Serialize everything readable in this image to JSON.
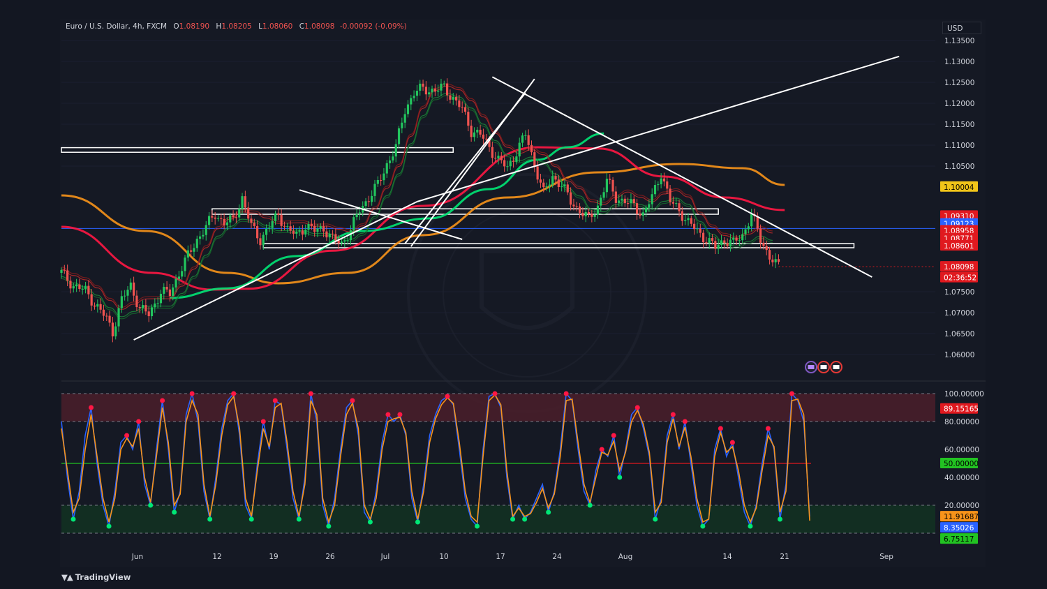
{
  "header": {
    "symbol": "Euro / U.S. Dollar, 4h, FXCM",
    "open_label": "O",
    "open": "1.08190",
    "high_label": "H",
    "high": "1.08205",
    "low_label": "L",
    "low": "1.08060",
    "close_label": "C",
    "close": "1.08098",
    "change": "-0.00092 (-0.09%)"
  },
  "currency_button": "USD",
  "brand": "TradingView",
  "colors": {
    "up": "#26a69a",
    "down": "#ef5350",
    "ema_fast": "#00e676",
    "ema_red": "#ff1744",
    "ma_orange": "#f7931a",
    "ma_olive": "#c9b037",
    "trendline": "#ffffff",
    "zone": "#ffffff",
    "stoch_k": "#2962ff",
    "stoch_d": "#f7931a",
    "overbought_fill": "#4a1f2a",
    "oversold_fill": "#123322"
  },
  "chart_data": [
    {
      "type": "candlestick",
      "title": "Euro / U.S. Dollar, 4h, FXCM",
      "x_ticks": [
        "Jun",
        "12",
        "19",
        "26",
        "Jul",
        "10",
        "17",
        "24",
        "Aug",
        "14",
        "21",
        "Sep"
      ],
      "y_ticks": [
        "1.13500",
        "1.13000",
        "1.12500",
        "1.12000",
        "1.11500",
        "1.11000",
        "1.10500",
        "1.07500",
        "1.07000",
        "1.06500",
        "1.06000"
      ],
      "ylim": [
        1.055,
        1.138
      ],
      "price_labels": [
        {
          "value": "1.10004",
          "color": "#f0c419",
          "text_color": "#000000",
          "price": 1.10004
        },
        {
          "value": "1.09310",
          "color": "#e0191f",
          "text_color": "#ffffff",
          "price": 1.0931
        },
        {
          "value": "1.09123",
          "color": "#2962ff",
          "text_color": "#ffffff",
          "price": 1.09123
        },
        {
          "value": "1.08958",
          "color": "#e0191f",
          "text_color": "#ffffff",
          "price": 1.08958
        },
        {
          "value": "1.08771",
          "color": "#e0191f",
          "text_color": "#ffffff",
          "price": 1.08771
        },
        {
          "value": "1.08601",
          "color": "#e0191f",
          "text_color": "#ffffff",
          "price": 1.08601
        },
        {
          "value": "1.08098",
          "color": "#e0191f",
          "text_color": "#ffffff",
          "price": 1.08098
        },
        {
          "value": "02:36:52",
          "color": "#e0191f",
          "text_color": "#ffffff",
          "price": 1.0784
        }
      ],
      "close_path": [
        [
          0,
          1.0795
        ],
        [
          4,
          1.0765
        ],
        [
          8,
          1.0752
        ],
        [
          11,
          1.0722
        ],
        [
          15,
          1.0685
        ],
        [
          17,
          1.0655
        ],
        [
          20,
          1.073
        ],
        [
          23,
          1.0765
        ],
        [
          26,
          1.071
        ],
        [
          29,
          1.0695
        ],
        [
          33,
          1.075
        ],
        [
          36,
          1.0745
        ],
        [
          39,
          1.0795
        ],
        [
          42,
          1.0835
        ],
        [
          45,
          1.0875
        ],
        [
          48,
          1.0905
        ],
        [
          51,
          1.0935
        ],
        [
          54,
          1.0915
        ],
        [
          57,
          1.092
        ],
        [
          60,
          1.0975
        ],
        [
          63,
          1.0905
        ],
        [
          66,
          1.0875
        ],
        [
          69,
          1.0905
        ],
        [
          72,
          1.0935
        ],
        [
          75,
          1.0898
        ],
        [
          78,
          1.0885
        ],
        [
          81,
          1.0908
        ],
        [
          84,
          1.0895
        ],
        [
          87,
          1.0903
        ],
        [
          90,
          1.0875
        ],
        [
          93,
          1.0865
        ],
        [
          96,
          1.0898
        ],
        [
          99,
          1.0945
        ],
        [
          102,
          1.0975
        ],
        [
          105,
          1.1005
        ],
        [
          108,
          1.1055
        ],
        [
          111,
          1.1095
        ],
        [
          114,
          1.1185
        ],
        [
          117,
          1.1225
        ],
        [
          120,
          1.1235
        ],
        [
          124,
          1.123
        ],
        [
          127,
          1.1238
        ],
        [
          130,
          1.1212
        ],
        [
          133,
          1.1185
        ],
        [
          136,
          1.1135
        ],
        [
          139,
          1.1125
        ],
        [
          142,
          1.1095
        ],
        [
          145,
          1.1065
        ],
        [
          148,
          1.1045
        ],
        [
          151,
          1.1085
        ],
        [
          154,
          1.1125
        ],
        [
          157,
          1.1055
        ],
        [
          160,
          1.0985
        ],
        [
          163,
          1.1025
        ],
        [
          166,
          1.1005
        ],
        [
          169,
          1.0965
        ],
        [
          172,
          1.0945
        ],
        [
          175,
          1.0922
        ],
        [
          178,
          1.0955
        ],
        [
          181,
          1.1015
        ],
        [
          184,
          1.0975
        ],
        [
          187,
          1.0965
        ],
        [
          190,
          1.0955
        ],
        [
          193,
          1.0935
        ],
        [
          196,
          1.0975
        ],
        [
          199,
          1.1035
        ],
        [
          202,
          1.0965
        ],
        [
          205,
          1.0945
        ],
        [
          208,
          1.0915
        ],
        [
          211,
          1.0895
        ],
        [
          214,
          1.0875
        ],
        [
          217,
          1.0855
        ],
        [
          220,
          1.0875
        ],
        [
          223,
          1.0865
        ],
        [
          226,
          1.0885
        ],
        [
          229,
          1.0935
        ],
        [
          232,
          1.0875
        ],
        [
          235,
          1.0835
        ],
        [
          237,
          1.0815
        ],
        [
          238,
          1.081
        ]
      ],
      "resistance_zones": [
        {
          "from": 0,
          "to": 130,
          "low": 1.1083,
          "high": 1.1094
        },
        {
          "from": 50,
          "to": 218,
          "low": 1.0935,
          "high": 1.0948
        },
        {
          "from": 67,
          "to": 263,
          "low": 1.0855,
          "high": 1.0865
        }
      ],
      "trendlines": [
        [
          [
            24,
            1.0635
          ],
          [
            118,
            1.0965
          ]
        ],
        [
          [
            118,
            1.0965
          ],
          [
            278,
            1.1312
          ]
        ],
        [
          [
            79,
            1.0993
          ],
          [
            133,
            1.0875
          ]
        ],
        [
          [
            143,
            1.1263
          ],
          [
            269,
            1.0785
          ]
        ],
        [
          [
            116,
            1.0858
          ],
          [
            157,
            1.1258
          ]
        ],
        [
          [
            114,
            1.0865
          ],
          [
            154,
            1.1225
          ]
        ]
      ],
      "horizontal_line": {
        "price": 1.0901,
        "color": "#2962ff"
      },
      "moving_averages": [
        {
          "color": "#f7931a",
          "points": [
            [
              0,
              1.098
            ],
            [
              28,
              1.0895
            ],
            [
              55,
              1.0795
            ],
            [
              72,
              1.077
            ],
            [
              95,
              1.0795
            ],
            [
              120,
              1.0885
            ],
            [
              148,
              1.0975
            ],
            [
              178,
              1.1035
            ],
            [
              205,
              1.1055
            ],
            [
              226,
              1.1045
            ],
            [
              240,
              1.1005
            ]
          ]
        },
        {
          "color": "#ff1744",
          "points": [
            [
              0,
              1.0905
            ],
            [
              30,
              1.0795
            ],
            [
              50,
              1.0755
            ],
            [
              62,
              1.0757
            ],
            [
              90,
              1.0848
            ],
            [
              120,
              1.0955
            ],
            [
              158,
              1.1095
            ],
            [
              178,
              1.1092
            ],
            [
              200,
              1.1025
            ],
            [
              220,
              1.0975
            ],
            [
              240,
              1.0945
            ]
          ]
        },
        {
          "color": "#00e676",
          "points": [
            [
              36,
              1.0735
            ],
            [
              55,
              1.0758
            ],
            [
              78,
              1.0835
            ],
            [
              100,
              1.0895
            ],
            [
              122,
              1.0925
            ],
            [
              142,
              1.0995
            ],
            [
              158,
              1.1065
            ],
            [
              168,
              1.1095
            ],
            [
              180,
              1.1128
            ]
          ]
        }
      ],
      "event_icons": [
        "lightning-icon",
        "us-flag-icon",
        "us-flag-icon"
      ]
    },
    {
      "type": "line",
      "title": "Stochastic",
      "y_ticks": [
        "100.00000",
        "80.00000",
        "60.00000",
        "40.00000",
        "20.00000"
      ],
      "ylim": [
        0,
        100
      ],
      "levels": {
        "overbought": 80,
        "middle": 50,
        "oversold": 20,
        "top": 100,
        "bottom": 0
      },
      "value_labels": [
        {
          "value": "89.15165",
          "color": "#e0191f",
          "text_color": "#ffffff",
          "level": 89.15
        },
        {
          "value": "50.00000",
          "color": "#22c322",
          "text_color": "#000000",
          "level": 50
        },
        {
          "value": "11.91687",
          "color": "#f7931a",
          "text_color": "#000000",
          "level": 11.92
        },
        {
          "value": "8.35026",
          "color": "#2962ff",
          "text_color": "#ffffff",
          "level": 8.35
        },
        {
          "value": "6.75117",
          "color": "#22c322",
          "text_color": "#000000",
          "level": 6.75
        }
      ],
      "series_k": [
        80,
        40,
        10,
        30,
        70,
        90,
        50,
        20,
        5,
        30,
        65,
        70,
        60,
        80,
        35,
        20,
        60,
        95,
        60,
        15,
        30,
        85,
        100,
        80,
        30,
        10,
        40,
        75,
        95,
        100,
        70,
        20,
        10,
        50,
        80,
        60,
        95,
        92,
        60,
        25,
        10,
        40,
        100,
        80,
        20,
        5,
        25,
        60,
        90,
        95,
        70,
        15,
        8,
        30,
        65,
        85,
        80,
        85,
        70,
        25,
        8,
        35,
        70,
        85,
        95,
        98,
        92,
        60,
        25,
        10,
        5,
        60,
        98,
        100,
        90,
        40,
        10,
        20,
        10,
        15,
        25,
        35,
        15,
        30,
        60,
        100,
        95,
        60,
        30,
        20,
        45,
        60,
        55,
        70,
        40,
        60,
        85,
        90,
        75,
        55,
        10,
        25,
        70,
        85,
        60,
        80,
        50,
        20,
        5,
        10,
        60,
        75,
        55,
        65,
        40,
        15,
        5,
        20,
        50,
        75,
        60,
        10,
        35,
        100,
        95,
        80,
        12
      ],
      "series_d": [
        75,
        45,
        15,
        25,
        60,
        85,
        55,
        25,
        8,
        25,
        60,
        68,
        62,
        75,
        40,
        22,
        55,
        90,
        65,
        20,
        28,
        80,
        95,
        85,
        35,
        12,
        35,
        70,
        92,
        98,
        75,
        25,
        12,
        45,
        75,
        62,
        90,
        93,
        65,
        30,
        12,
        35,
        95,
        85,
        25,
        8,
        20,
        55,
        85,
        93,
        75,
        20,
        10,
        25,
        60,
        80,
        82,
        83,
        72,
        30,
        10,
        30,
        65,
        82,
        92,
        97,
        93,
        65,
        30,
        12,
        8,
        55,
        95,
        99,
        92,
        45,
        12,
        18,
        12,
        14,
        22,
        32,
        18,
        28,
        55,
        95,
        96,
        65,
        35,
        22,
        40,
        58,
        56,
        66,
        45,
        58,
        80,
        88,
        78,
        58,
        15,
        22,
        65,
        82,
        62,
        76,
        55,
        25,
        8,
        10,
        55,
        72,
        58,
        62,
        45,
        20,
        8,
        18,
        45,
        70,
        62,
        15,
        30,
        95,
        96,
        85,
        9
      ]
    }
  ]
}
